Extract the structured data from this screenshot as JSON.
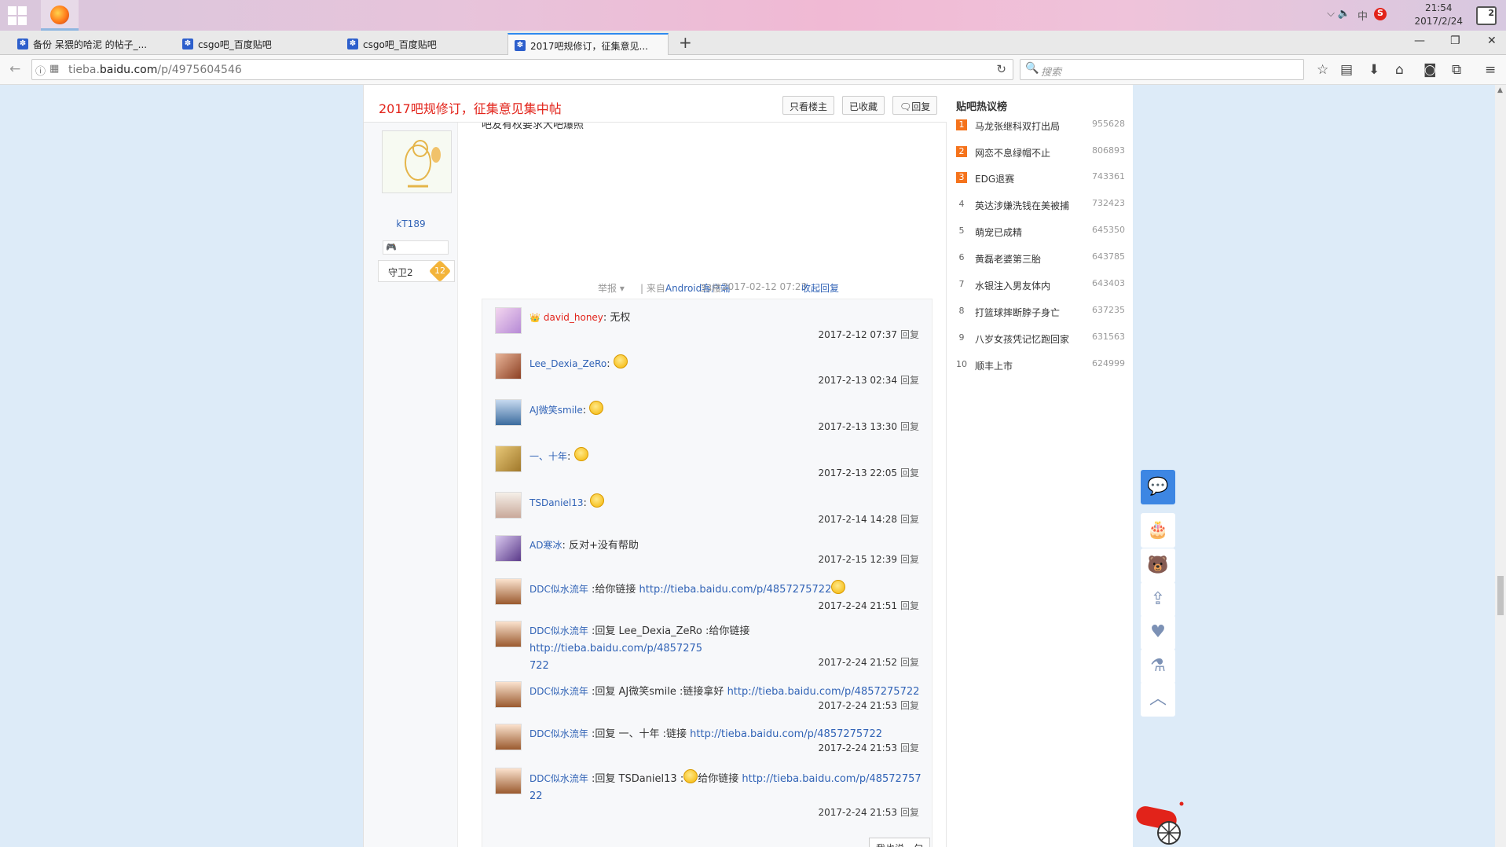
{
  "taskbar": {
    "clock_time": "21:54",
    "clock_date": "2017/2/24",
    "tray_input": "中",
    "tray_ime": "S",
    "notif_count": "2"
  },
  "tabs": [
    {
      "label": "备份 呆猥的哈泥 的帖子_..."
    },
    {
      "label": "csgo吧_百度贴吧"
    },
    {
      "label": "csgo吧_百度贴吧"
    },
    {
      "label": "2017吧规修订，征集意见..."
    }
  ],
  "nav": {
    "url_prefix": "tieba.",
    "url_domain": "baidu.com",
    "url_path": "/p/4975604546",
    "search_placeholder": "搜索"
  },
  "thread": {
    "title": "2017吧规修订，征集意见集中帖",
    "btn_author": "只看楼主",
    "btn_fav": "已收藏",
    "btn_reply": "回复"
  },
  "author": {
    "name": "kT189",
    "level_name": "守卫2",
    "level": "12"
  },
  "post": {
    "cut_text": "吧友有权要求大吧爆照",
    "report": "举报",
    "from_label": "| 来自",
    "client": "Android客户端",
    "floor": "33楼",
    "time": "2017-02-12 07:23",
    "collapse": "收起回复"
  },
  "comments": [
    {
      "user": "david_honey",
      "sep": ":",
      "text": " 无权",
      "link": "",
      "link2": "",
      "time": "2017-2-12 07:37",
      "reply": "回复"
    },
    {
      "user": "Lee_Dexia_ZeRo",
      "sep": ":",
      "text": "",
      "link": "",
      "link2": "",
      "time": "2017-2-13 02:34",
      "reply": "回复"
    },
    {
      "user": "AJ微笑smile",
      "sep": ":",
      "text": "",
      "link": "",
      "link2": "",
      "time": "2017-2-13 13:30",
      "reply": "回复"
    },
    {
      "user": "一、十年",
      "sep": ":",
      "text": "",
      "link": "",
      "link2": "",
      "time": "2017-2-13 22:05",
      "reply": "回复"
    },
    {
      "user": "TSDaniel13",
      "sep": ":",
      "text": "",
      "link": "",
      "link2": "",
      "time": "2017-2-14 14:28",
      "reply": "回复"
    },
    {
      "user": "AD寒冰",
      "sep": ":",
      "text": " 反对+没有帮助",
      "link": "",
      "link2": "",
      "time": "2017-2-15 12:39",
      "reply": "回复"
    },
    {
      "user": "DDC似水流年",
      "sep": " :",
      "text": "给你链接 ",
      "link": "http://tieba.baidu.com/p/4857275722",
      "link2": "",
      "time": "2017-2-24 21:51",
      "reply": "回复"
    },
    {
      "user": "DDC似水流年",
      "sep": " :",
      "text": "回复 Lee_Dexia_ZeRo :给你链接 ",
      "link": "http://tieba.baidu.com/p/4857275",
      "link2": "722",
      "time": "2017-2-24 21:52",
      "reply": "回复"
    },
    {
      "user": "DDC似水流年",
      "sep": " :",
      "text": "回复 AJ微笑smile :链接拿好 ",
      "link": "http://tieba.baidu.com/p/4857275722",
      "link2": "",
      "time": "2017-2-24 21:53",
      "reply": "回复"
    },
    {
      "user": "DDC似水流年",
      "sep": " :",
      "text": "回复 一、十年 :链接 ",
      "link": "http://tieba.baidu.com/p/4857275722",
      "link2": "",
      "time": "2017-2-24 21:53",
      "reply": "回复"
    },
    {
      "user": "DDC似水流年",
      "sep": " :",
      "text": "回复 TSDaniel13 :",
      "text2": "给你链接 ",
      "link": "http://tieba.baidu.com/p/48572757",
      "link2": "22",
      "time": "2017-2-24 21:53",
      "reply": "回复"
    }
  ],
  "reply_box_btn": "我也说一句",
  "sidebar": {
    "title": "贴吧热议榜",
    "items": [
      {
        "rank": "1",
        "title": "马龙张继科双打出局",
        "count": "955628"
      },
      {
        "rank": "2",
        "title": "网恋不息绿帽不止",
        "count": "806893"
      },
      {
        "rank": "3",
        "title": "EDG退赛",
        "count": "743361"
      },
      {
        "rank": "4",
        "title": "英达涉嫌洗钱在美被捕",
        "count": "732423"
      },
      {
        "rank": "5",
        "title": "萌宠已成精",
        "count": "645350"
      },
      {
        "rank": "6",
        "title": "黄磊老婆第三胎",
        "count": "643785"
      },
      {
        "rank": "7",
        "title": "水银注入男友体内",
        "count": "643403"
      },
      {
        "rank": "8",
        "title": "打篮球摔断脖子身亡",
        "count": "637235"
      },
      {
        "rank": "9",
        "title": "八岁女孩凭记忆跑回家",
        "count": "631563"
      },
      {
        "rank": "10",
        "title": "顺丰上市",
        "count": "624999"
      }
    ]
  },
  "colors": {
    "accent": "#3d86e3",
    "title_red": "#e2231a",
    "link_blue": "#3163b6",
    "hot_orange": "#f5731c"
  }
}
